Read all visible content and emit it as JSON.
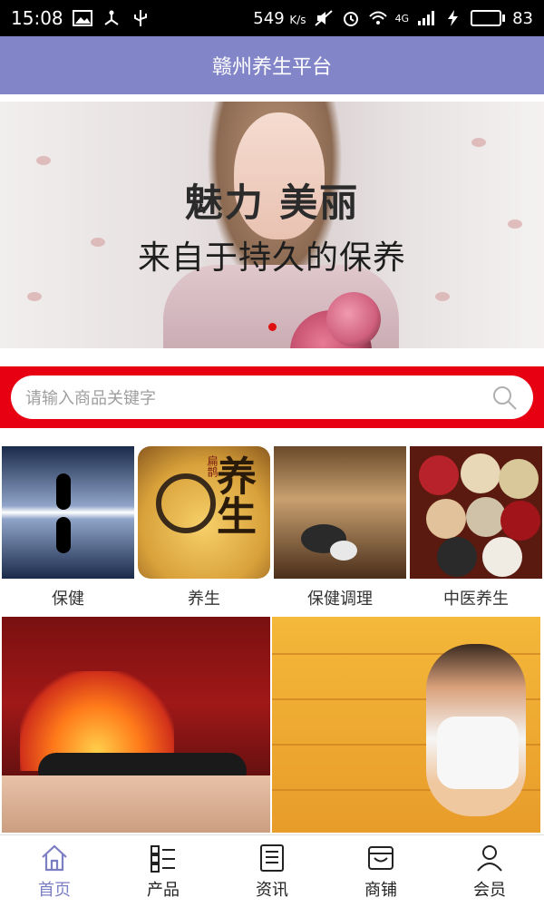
{
  "status_bar": {
    "time": "15:08",
    "speed": "549",
    "speed_unit": "K/s",
    "network": "4G",
    "battery": "83",
    "battery_level": 0.83
  },
  "header": {
    "title": "赣州养生平台"
  },
  "banner": {
    "headline": "魅力 美丽",
    "subline": "来自于持久的保养",
    "active_dot_color": "#e01010"
  },
  "search": {
    "placeholder": "请输入商品关键字"
  },
  "categories": [
    {
      "label": "保健"
    },
    {
      "label": "养生",
      "art_text": "养生",
      "art_small": "扁鹊"
    },
    {
      "label": "保健调理"
    },
    {
      "label": "中医养生"
    }
  ],
  "bottom_nav": [
    {
      "label": "首页",
      "icon": "home-icon",
      "active": true
    },
    {
      "label": "产品",
      "icon": "list-icon"
    },
    {
      "label": "资讯",
      "icon": "news-icon"
    },
    {
      "label": "商铺",
      "icon": "shop-icon"
    },
    {
      "label": "会员",
      "icon": "user-icon"
    }
  ],
  "colors": {
    "header_bg": "#8385c9",
    "search_band": "#e60012",
    "nav_active": "#7c7ec4"
  }
}
